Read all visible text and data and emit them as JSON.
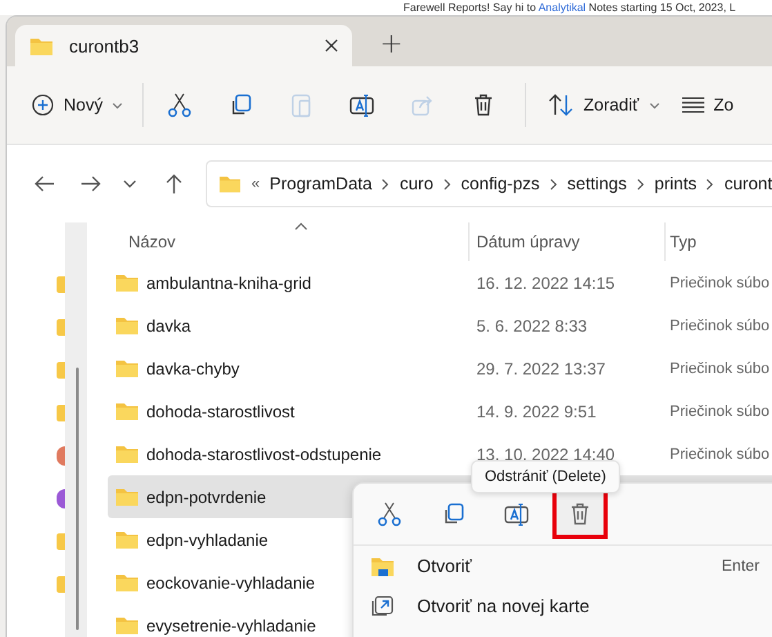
{
  "banner": {
    "text_before": "Farewell Reports! Say hi to ",
    "link": "Analytikal",
    "text_after": " Notes starting 15 Oct, 2023, L"
  },
  "tabs": [
    {
      "label": "curontb3",
      "selected": true
    }
  ],
  "new_tab": "+",
  "toolbar": {
    "new_label": "Nový",
    "actions": [
      {
        "kind": "cut",
        "disabled": false
      },
      {
        "kind": "copy",
        "disabled": false
      },
      {
        "kind": "paste",
        "disabled": true
      },
      {
        "kind": "rename",
        "disabled": false
      },
      {
        "kind": "share",
        "disabled": true
      },
      {
        "kind": "delete",
        "disabled": false
      }
    ],
    "sort_label": "Zoradiť",
    "view_label": "Zo"
  },
  "address": {
    "prefix": "«",
    "crumbs": [
      "ProgramData",
      "curo",
      "config-pzs",
      "settings",
      "prints",
      "curont"
    ]
  },
  "nav_pane": [
    {
      "kind": "folder"
    },
    {
      "kind": "folder"
    },
    {
      "kind": "folder"
    },
    {
      "kind": "folder"
    },
    {
      "kind": "dot",
      "color": "#e07a5f"
    },
    {
      "kind": "dot",
      "color": "#9b59d6"
    },
    {
      "kind": "folder"
    },
    {
      "kind": "folder"
    }
  ],
  "columns": [
    "Názov",
    "Dátum úpravy",
    "Typ"
  ],
  "rows": [
    {
      "name": "ambulantna-kniha-grid",
      "date": "16. 12. 2022 14:15",
      "type": "Priečinok súbo",
      "selected": false
    },
    {
      "name": "davka",
      "date": "5. 6. 2022 8:33",
      "type": "Priečinok súbo",
      "selected": false
    },
    {
      "name": "davka-chyby",
      "date": "29. 7. 2022 13:37",
      "type": "Priečinok súbo",
      "selected": false
    },
    {
      "name": "dohoda-starostlivost",
      "date": "14. 9. 2022 9:51",
      "type": "Priečinok súbo",
      "selected": false
    },
    {
      "name": "dohoda-starostlivost-odstupenie",
      "date": "13. 10. 2022 14:40",
      "type": "Priečinok súbo",
      "selected": false
    },
    {
      "name": "edpn-potvrdenie",
      "selected": true
    },
    {
      "name": "edpn-vyhladanie",
      "selected": false
    },
    {
      "name": "eockovanie-vyhladanie",
      "selected": false
    },
    {
      "name": "evysetrenie-vyhladanie",
      "selected": false
    }
  ],
  "tooltip": "Odstrániť (Delete)",
  "context_menu": {
    "actions": [
      {
        "kind": "cut",
        "highlighted": false
      },
      {
        "kind": "copy",
        "highlighted": false
      },
      {
        "kind": "rename",
        "highlighted": false
      },
      {
        "kind": "delete",
        "highlighted": true
      }
    ],
    "items": [
      {
        "kind": "open",
        "label": "Otvoriť",
        "shortcut": "Enter"
      },
      {
        "kind": "new-tab",
        "label": "Otvoriť na novej karte"
      }
    ]
  }
}
